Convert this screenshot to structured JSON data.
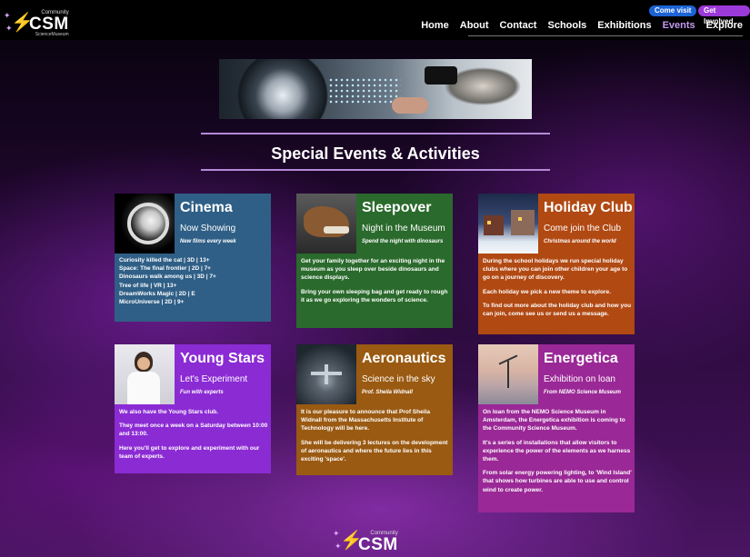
{
  "brand": {
    "community": "Community",
    "name": "CSM",
    "sub": "ScienceMuseum"
  },
  "header": {
    "visit_label": "Come visit",
    "involved_label": "Get Involved",
    "nav": [
      "Home",
      "About",
      "Contact",
      "Schools",
      "Exhibitions",
      "Events",
      "Explore"
    ],
    "active_nav": "Events"
  },
  "page": {
    "heading": "Special Events & Activities"
  },
  "cards": [
    {
      "title": "Cinema",
      "subtitle": "Now Showing",
      "tag": "New films every week",
      "color": "#2f5f86",
      "lines": [
        "Curiosity killed the cat | 3D | 13+",
        "Space: The final frontier | 2D | 7+",
        "Dinosaurs walk among us | 3D | 7+",
        "Tree of life | VR | 13+",
        "DreamWorks Magic | 2D | E",
        "MicroUniverse | 2D | 9+"
      ]
    },
    {
      "title": "Sleepover",
      "subtitle": "Night in the Museum",
      "tag": "Spend the night with dinosaurs",
      "color": "#2a6a2c",
      "paragraphs": [
        "Get your family together for an exciting night in the museum as you sleep over beside dinosaurs and science displays.",
        "Bring your own sleeping bag and get ready to rough it as we go exploring the wonders of science."
      ]
    },
    {
      "title": "Holiday Club",
      "subtitle": "Come join the Club",
      "tag": "Christmas around the world",
      "color": "#b14913",
      "paragraphs": [
        "During the school holidays we run special holiday clubs where you can join other children your age to go on a journey of discovery.",
        "Each holiday we pick a new theme to explore.",
        "To find out more about the holiday club and how you can join, come see us or send us a message."
      ]
    },
    {
      "title": "Young Stars",
      "subtitle": "Let's Experiment",
      "tag": "Fun with experts",
      "color": "#8b2bd4",
      "paragraphs": [
        "We also have the Young Stars club.",
        "They meet once a week on a Saturday between 10:00 and 13:00.",
        "Here you'll get to explore and experiment with our team of experts."
      ]
    },
    {
      "title": "Aeronautics",
      "subtitle": "Science in the sky",
      "tag": "Prof. Sheila Widnall",
      "color": "#9a5a12",
      "paragraphs": [
        "It is our pleasure to announce that Prof Sheila Widnall from the Massachusetts Institute of Technology will be here.",
        "She will be delivering 3 lectures on the development of aeronautics and where the future lies in this exciting 'space'."
      ]
    },
    {
      "title": "Energetica",
      "subtitle": "Exhibition on loan",
      "tag": "From NEMO Science Museum",
      "color": "#9a2896",
      "paragraphs": [
        "On loan from the NEMO Science Museum in Amsterdam, the Energetica exhibition is coming to the Community Science Museum.",
        "It's a series of installations that allow visitors to experience the power of the elements as we harness them.",
        "From solar energy powering lighting, to 'Wind Island' that shows how turbines are able to use and control wind to create power."
      ]
    }
  ]
}
